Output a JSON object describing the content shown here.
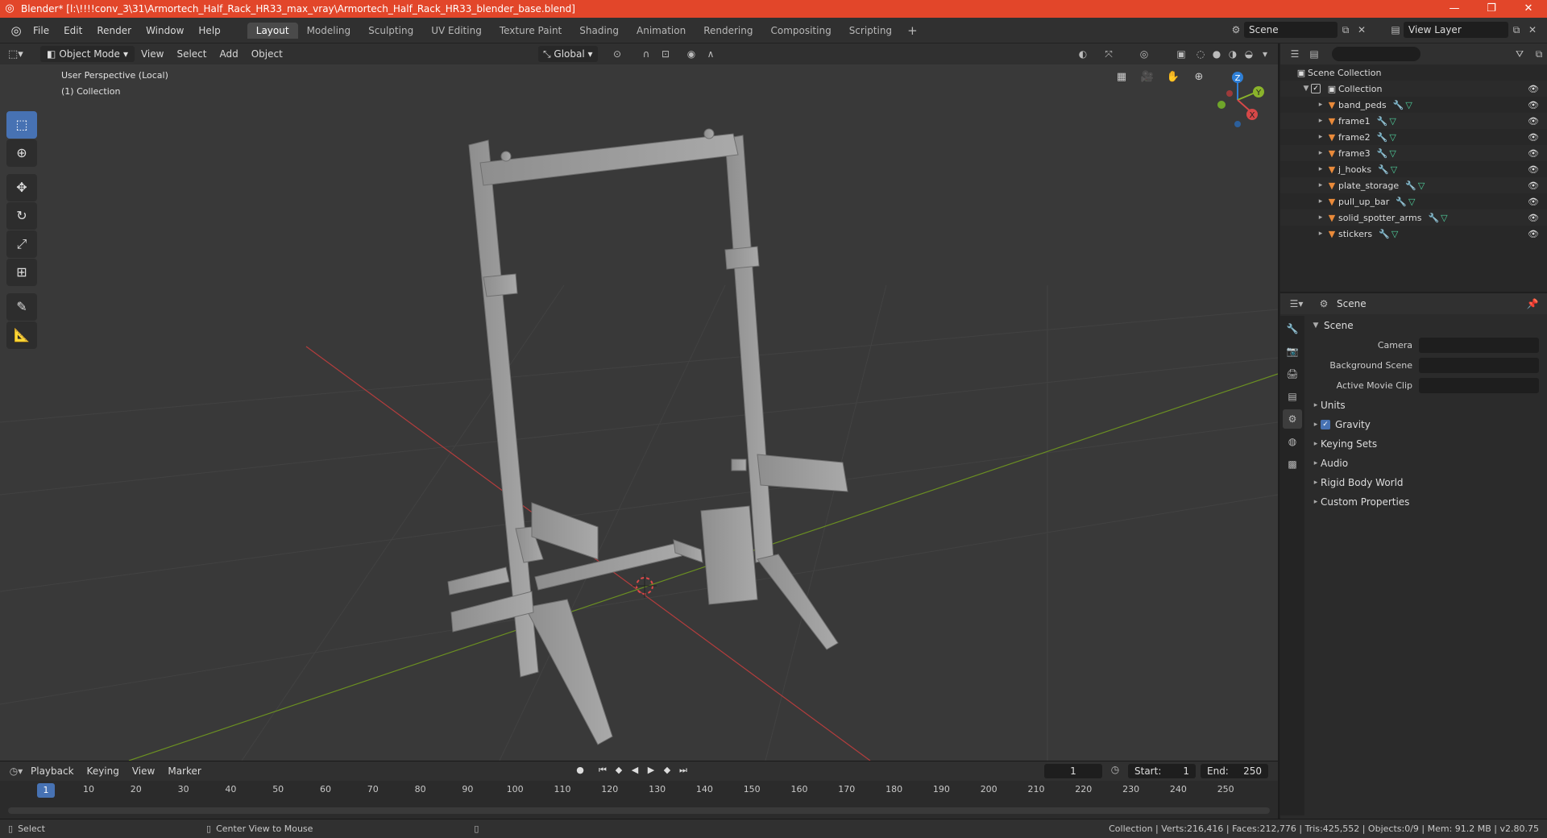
{
  "window": {
    "title": "Blender* [l:\\!!!!conv_3\\31\\Armortech_Half_Rack_HR33_max_vray\\Armortech_Half_Rack_HR33_blender_base.blend]",
    "minimize": "—",
    "restore": "❐",
    "close": "✕"
  },
  "menubar": {
    "items": [
      "File",
      "Edit",
      "Render",
      "Window",
      "Help"
    ],
    "workspaces": [
      "Layout",
      "Modeling",
      "Sculpting",
      "UV Editing",
      "Texture Paint",
      "Shading",
      "Animation",
      "Rendering",
      "Compositing",
      "Scripting"
    ],
    "add_workspace": "+",
    "scene": "Scene",
    "view_layer": "View Layer"
  },
  "viewport": {
    "mode": "Object Mode",
    "menus": [
      "View",
      "Select",
      "Add",
      "Object"
    ],
    "orientation": "Global",
    "info_line1": "User Perspective (Local)",
    "info_line2": "(1) Collection",
    "gizmo": {
      "z": "Z",
      "y": "Y",
      "x": "X"
    }
  },
  "outliner": {
    "search_placeholder": "",
    "scene_collection": "Scene Collection",
    "collection": "Collection",
    "objects": [
      "band_peds",
      "frame1",
      "frame2",
      "frame3",
      "j_hooks",
      "plate_storage",
      "pull_up_bar",
      "solid_spotter_arms",
      "stickers"
    ]
  },
  "properties": {
    "header": "Scene",
    "panel": "Scene",
    "fields": [
      {
        "label": "Camera",
        "value": ""
      },
      {
        "label": "Background Scene",
        "value": ""
      },
      {
        "label": "Active Movie Clip",
        "value": ""
      }
    ],
    "subpanels": [
      "Units",
      "Gravity",
      "Keying Sets",
      "Audio",
      "Rigid Body World",
      "Custom Properties"
    ]
  },
  "timeline": {
    "menus": [
      "Playback",
      "Keying",
      "View",
      "Marker"
    ],
    "current_frame": "1",
    "start_label": "Start:",
    "start": "1",
    "end_label": "End:",
    "end": "250",
    "ticks": [
      "1",
      "10",
      "20",
      "30",
      "40",
      "50",
      "60",
      "70",
      "80",
      "90",
      "100",
      "110",
      "120",
      "130",
      "140",
      "150",
      "160",
      "170",
      "180",
      "190",
      "200",
      "210",
      "220",
      "230",
      "240",
      "250"
    ]
  },
  "statusbar": {
    "left_action": "Select",
    "mid_action": "Center View to Mouse",
    "stats": "Collection | Verts:216,416 | Faces:212,776 | Tris:425,552 | Objects:0/9 | Mem: 91.2 MB | v2.80.75"
  }
}
